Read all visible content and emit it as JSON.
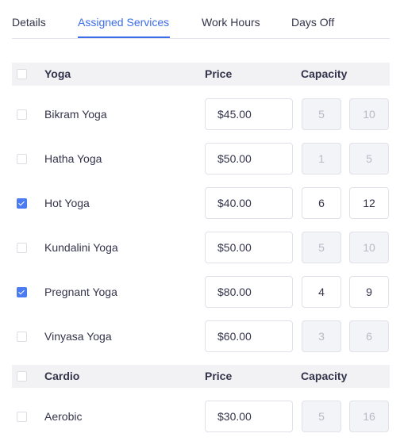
{
  "tabs": [
    {
      "label": "Details",
      "active": false
    },
    {
      "label": "Assigned Services",
      "active": true
    },
    {
      "label": "Work Hours",
      "active": false
    },
    {
      "label": "Days Off",
      "active": false
    }
  ],
  "colors": {
    "accent": "#3b6de8",
    "checkbox_checked": "#4b7bf0",
    "header_bg": "#f2f2f5",
    "disabled_bg": "#f3f4f8",
    "text": "#33344a"
  },
  "groups": [
    {
      "name": "Yoga",
      "price_header": "Price",
      "capacity_header": "Capacity",
      "checked": false,
      "services": [
        {
          "name": "Bikram Yoga",
          "checked": false,
          "price": "$45.00",
          "min_capacity": "5",
          "max_capacity": "10"
        },
        {
          "name": "Hatha Yoga",
          "checked": false,
          "price": "$50.00",
          "min_capacity": "1",
          "max_capacity": "5"
        },
        {
          "name": "Hot Yoga",
          "checked": true,
          "price": "$40.00",
          "min_capacity": "6",
          "max_capacity": "12"
        },
        {
          "name": "Kundalini Yoga",
          "checked": false,
          "price": "$50.00",
          "min_capacity": "5",
          "max_capacity": "10"
        },
        {
          "name": "Pregnant Yoga",
          "checked": true,
          "price": "$80.00",
          "min_capacity": "4",
          "max_capacity": "9"
        },
        {
          "name": "Vinyasa Yoga",
          "checked": false,
          "price": "$60.00",
          "min_capacity": "3",
          "max_capacity": "6"
        }
      ]
    },
    {
      "name": "Cardio",
      "price_header": "Price",
      "capacity_header": "Capacity",
      "checked": false,
      "services": [
        {
          "name": "Aerobic",
          "checked": false,
          "price": "$30.00",
          "min_capacity": "5",
          "max_capacity": "16"
        }
      ]
    }
  ]
}
